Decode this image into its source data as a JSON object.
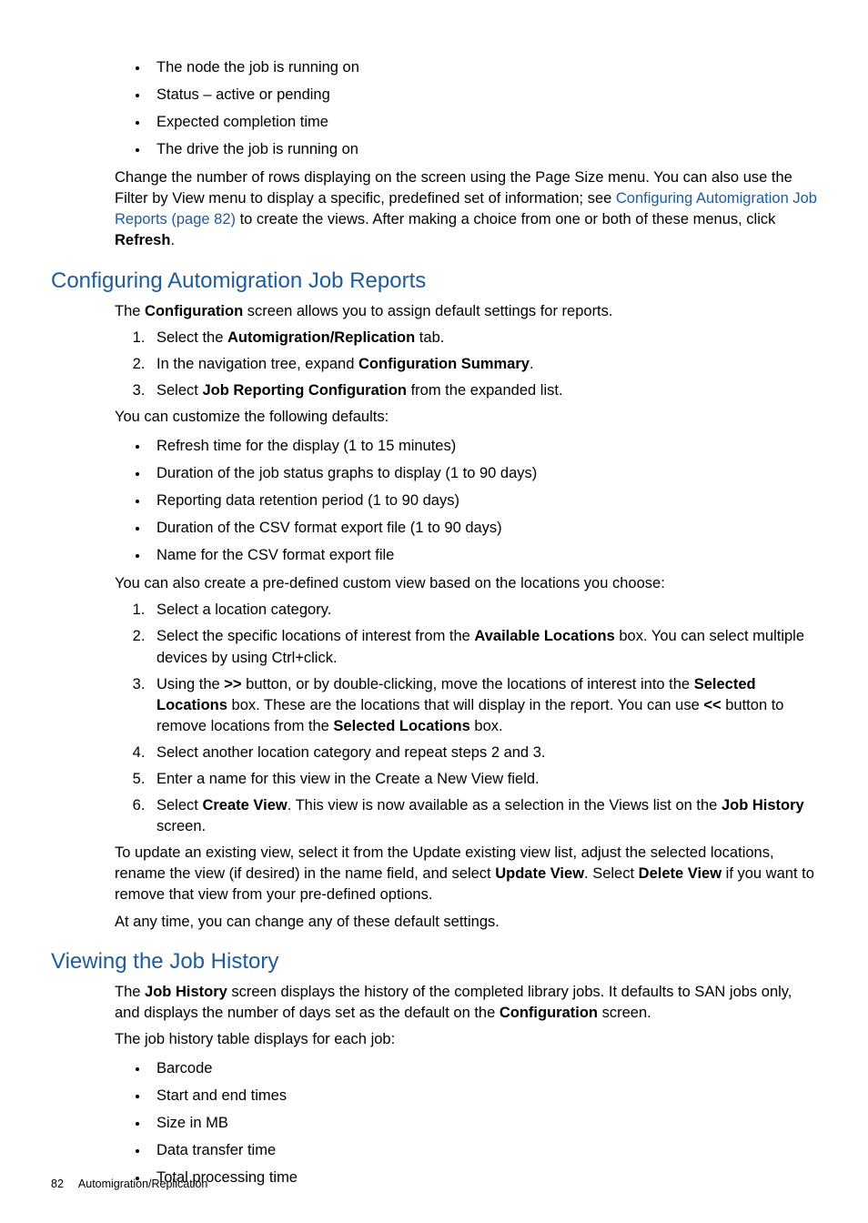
{
  "intro_bullets": [
    "The node the job is running on",
    "Status – active or pending",
    "Expected completion time",
    "The drive the job is running on"
  ],
  "intro_para": {
    "t1": "Change the number of rows displaying on the screen using the Page Size menu. You can also use the Filter by View menu to display a specific, predefined set of information; see ",
    "link": "Configuring Automigration Job Reports (page 82)",
    "t2": " to create the views. After making a choice from one or both of these menus, click ",
    "bold": "Refresh",
    "t3": "."
  },
  "s1": {
    "heading": "Configuring Automigration Job Reports",
    "p1": {
      "t1": "The ",
      "b1": "Configuration",
      "t2": " screen allows you to assign default settings for reports."
    },
    "steps1": {
      "i1": {
        "t1": "Select the ",
        "b1": "Automigration/Replication",
        "t2": " tab."
      },
      "i2": {
        "t1": "In the navigation tree, expand ",
        "b1": "Configuration Summary",
        "t2": "."
      },
      "i3": {
        "t1": "Select ",
        "b1": "Job Reporting Configuration",
        "t2": " from the expanded list."
      }
    },
    "p2": "You can customize the following defaults:",
    "defaults": [
      "Refresh time for the display (1 to 15 minutes)",
      "Duration of the job status graphs to display (1 to 90 days)",
      "Reporting data retention period (1 to 90 days)",
      "Duration of the CSV format export file (1 to 90 days)",
      "Name for the CSV format export file"
    ],
    "p3": "You can also create a pre-defined custom view based on the locations you choose:",
    "steps2": {
      "i1": "Select a location category.",
      "i2": {
        "t1": "Select the specific locations of interest from the ",
        "b1": "Available Locations",
        "t2": " box. You can select multiple devices by using Ctrl+click."
      },
      "i3": {
        "t1": "Using the ",
        "b1": ">>",
        "t2": " button, or by double-clicking, move the locations of interest into the ",
        "b2": "Selected Locations",
        "t3": " box. These are the locations that will display in the report. You can use ",
        "b3": "<<",
        "t4": " button to remove locations from the ",
        "b4": "Selected Locations",
        "t5": " box."
      },
      "i4": "Select another location category and repeat steps 2 and 3.",
      "i5": "Enter a name for this view in the Create a New View field.",
      "i6": {
        "t1": "Select ",
        "b1": "Create View",
        "t2": ". This view is now available as a selection in the Views list on the ",
        "b2": "Job History",
        "t3": " screen."
      }
    },
    "p4": {
      "t1": "To update an existing view, select it from the Update existing view list, adjust the selected locations, rename the view (if desired) in the name field, and select ",
      "b1": "Update View",
      "t2": ". Select ",
      "b2": "Delete View",
      "t3": " if you want to remove that view from your pre-defined options."
    },
    "p5": "At any time, you can change any of these default settings."
  },
  "s2": {
    "heading": "Viewing the Job History",
    "p1": {
      "t1": "The ",
      "b1": "Job History",
      "t2": " screen displays the history of the completed library jobs. It defaults to SAN jobs only, and displays the number of days set as the default on the ",
      "b2": "Configuration",
      "t3": " screen."
    },
    "p2": "The job history table displays for each job:",
    "bullets": [
      "Barcode",
      "Start and end times",
      "Size in MB",
      "Data transfer time",
      "Total processing time"
    ]
  },
  "footer": {
    "page_num": "82",
    "section": "Automigration/Replication"
  }
}
